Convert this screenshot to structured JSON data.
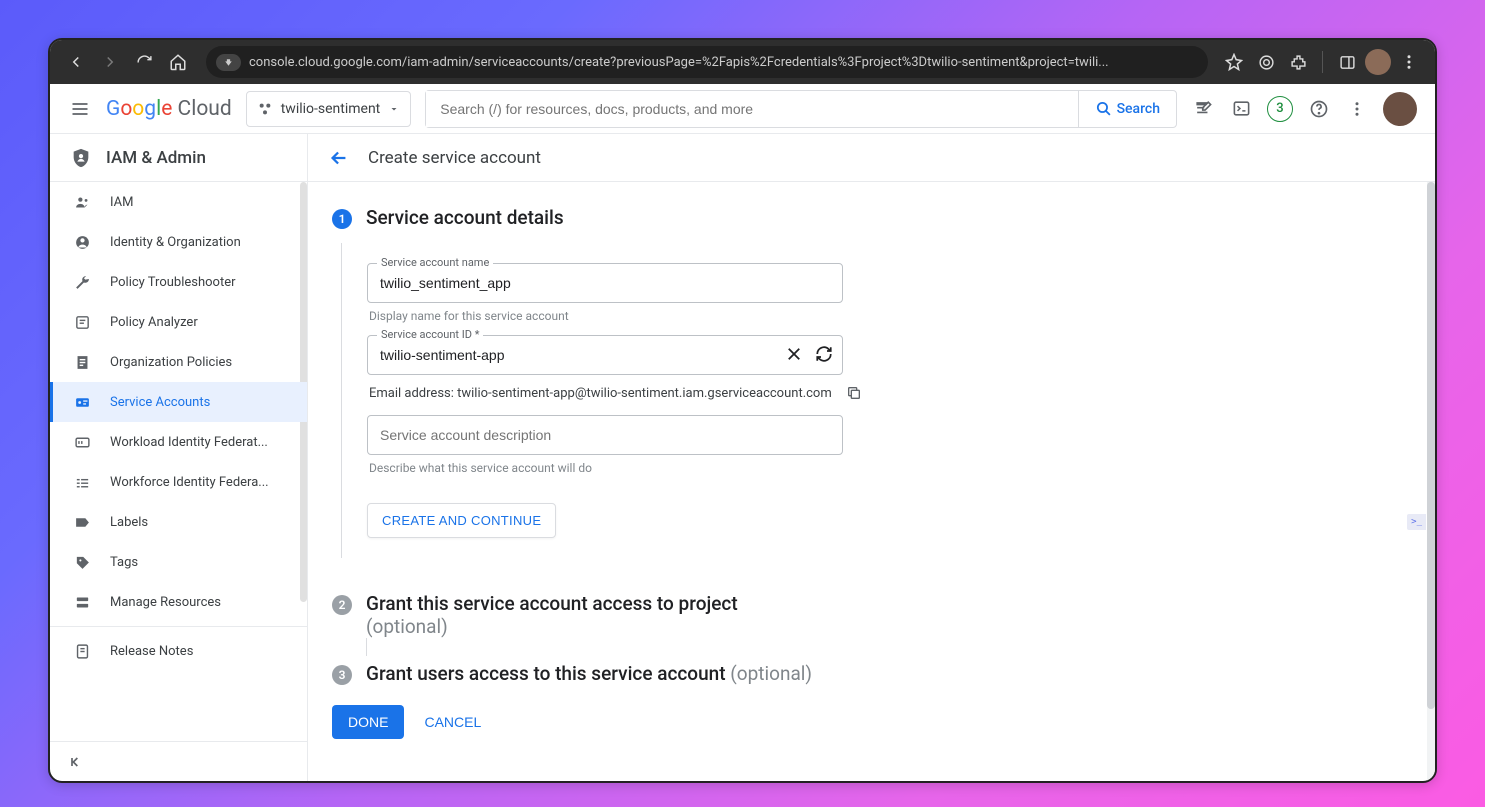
{
  "browser": {
    "url": "console.cloud.google.com/iam-admin/serviceaccounts/create?previousPage=%2Fapis%2Fcredentials%3Fproject%3Dtwilio-sentiment&project=twili..."
  },
  "header": {
    "logo_part1": "Google ",
    "logo_part2": "Cloud",
    "project_name": "twilio-sentiment",
    "search_placeholder": "Search (/) for resources, docs, products, and more",
    "search_button": "Search",
    "badge_count": "3"
  },
  "sidebar": {
    "title": "IAM & Admin",
    "items": [
      {
        "label": "IAM",
        "icon": "iam",
        "active": false
      },
      {
        "label": "Identity & Organization",
        "icon": "identity",
        "active": false
      },
      {
        "label": "Policy Troubleshooter",
        "icon": "wrench",
        "active": false
      },
      {
        "label": "Policy Analyzer",
        "icon": "analyzer",
        "active": false
      },
      {
        "label": "Organization Policies",
        "icon": "article",
        "active": false
      },
      {
        "label": "Service Accounts",
        "icon": "service",
        "active": true
      },
      {
        "label": "Workload Identity Federat...",
        "icon": "workload",
        "active": false
      },
      {
        "label": "Workforce Identity Federa...",
        "icon": "workforce",
        "active": false
      },
      {
        "label": "Labels",
        "icon": "label",
        "active": false
      },
      {
        "label": "Tags",
        "icon": "tag",
        "active": false
      },
      {
        "label": "Manage Resources",
        "icon": "manage",
        "active": false
      }
    ],
    "footer_item": {
      "label": "Release Notes",
      "icon": "notes"
    }
  },
  "main": {
    "page_title": "Create service account",
    "step1": {
      "title": "Service account details",
      "name_label": "Service account name",
      "name_value": "twilio_sentiment_app",
      "name_hint": "Display name for this service account",
      "id_label": "Service account ID *",
      "id_value": "twilio-sentiment-app",
      "email_label": "Email address: ",
      "email_value": "twilio-sentiment-app@twilio-sentiment.iam.gserviceaccount.com",
      "desc_placeholder": "Service account description",
      "desc_hint": "Describe what this service account will do",
      "continue_button": "CREATE AND CONTINUE"
    },
    "step2": {
      "title": "Grant this service account access to project",
      "optional": "(optional)"
    },
    "step3": {
      "title": "Grant users access to this service account",
      "optional": "(optional)"
    },
    "done_button": "DONE",
    "cancel_button": "CANCEL",
    "shell_hint": ">_"
  }
}
